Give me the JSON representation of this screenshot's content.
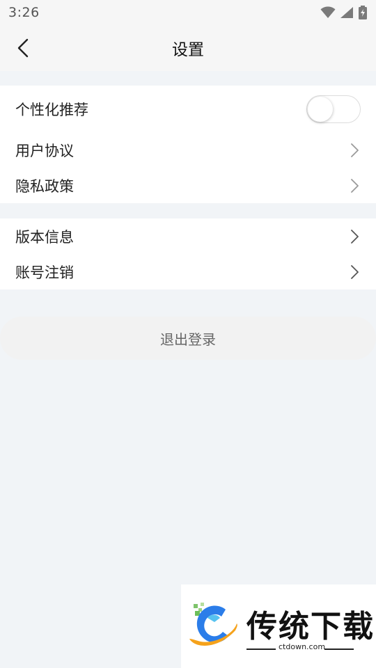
{
  "status_bar": {
    "time": "3:26"
  },
  "nav": {
    "title": "设置"
  },
  "settings": {
    "personalized_recommendation": {
      "label": "个性化推荐",
      "enabled": false
    },
    "user_agreement": {
      "label": "用户协议"
    },
    "privacy_policy": {
      "label": "隐私政策"
    },
    "version_info": {
      "label": "版本信息"
    },
    "account_cancellation": {
      "label": "账号注销"
    }
  },
  "logout": {
    "label": "退出登录"
  },
  "watermark": {
    "title": "传统下载",
    "domain": "ctdown.com"
  },
  "colors": {
    "background": "#f1f4f7",
    "card": "#ffffff",
    "text": "#222222",
    "logo_blue": "#2b7de9",
    "logo_orange": "#f5a21b",
    "logo_green": "#7ec36b"
  }
}
